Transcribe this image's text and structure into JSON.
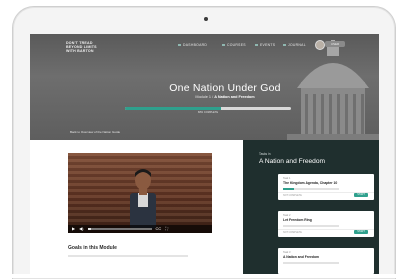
{
  "colors": {
    "accent": "#2fa08d",
    "sidebar_bg": "#1f2f2e",
    "hero_bg": "#5a5a5a"
  },
  "logo": {
    "lines": [
      "DON'T TREAD",
      "BEYOND LIMITS",
      "WITH BARTON"
    ]
  },
  "nav": {
    "items": [
      {
        "label": "DASHBOARD"
      },
      {
        "label": "COURSES"
      },
      {
        "label": "EVENTS"
      },
      {
        "label": "JOURNAL"
      }
    ],
    "user_label": "USER"
  },
  "hero": {
    "title": "One Nation Under God",
    "breadcrumb_module": "Module 1",
    "breadcrumb_sep": "/",
    "breadcrumb_current": "A Nation and Freedom",
    "progress_percent": 58,
    "progress_label": "68% COMPLETE",
    "back_link": "Back to Overview of the Nation Guide"
  },
  "video": {
    "controls": {
      "play": "▶",
      "volume": "◀)",
      "cc": "CC",
      "fullscreen": "⛶"
    },
    "progress_percent": 6
  },
  "main": {
    "goals_heading": "Goals in this Module"
  },
  "sidebar": {
    "kicker": "Tasks in",
    "title": "A Nation and Freedom",
    "cards": [
      {
        "small": "Task 1",
        "name": "The Kingdom Agenda, Chapter 10",
        "status": "NOT COMPLETE",
        "button": "START",
        "progress_percent": 20
      },
      {
        "small": "Task 2",
        "name": "Let Freedom Ring",
        "status": "NOT COMPLETE",
        "button": "START",
        "progress_percent": 0
      },
      {
        "small": "Task 3",
        "name": "A Nation and Freedom",
        "status": "",
        "button": "",
        "progress_percent": 0
      }
    ]
  }
}
